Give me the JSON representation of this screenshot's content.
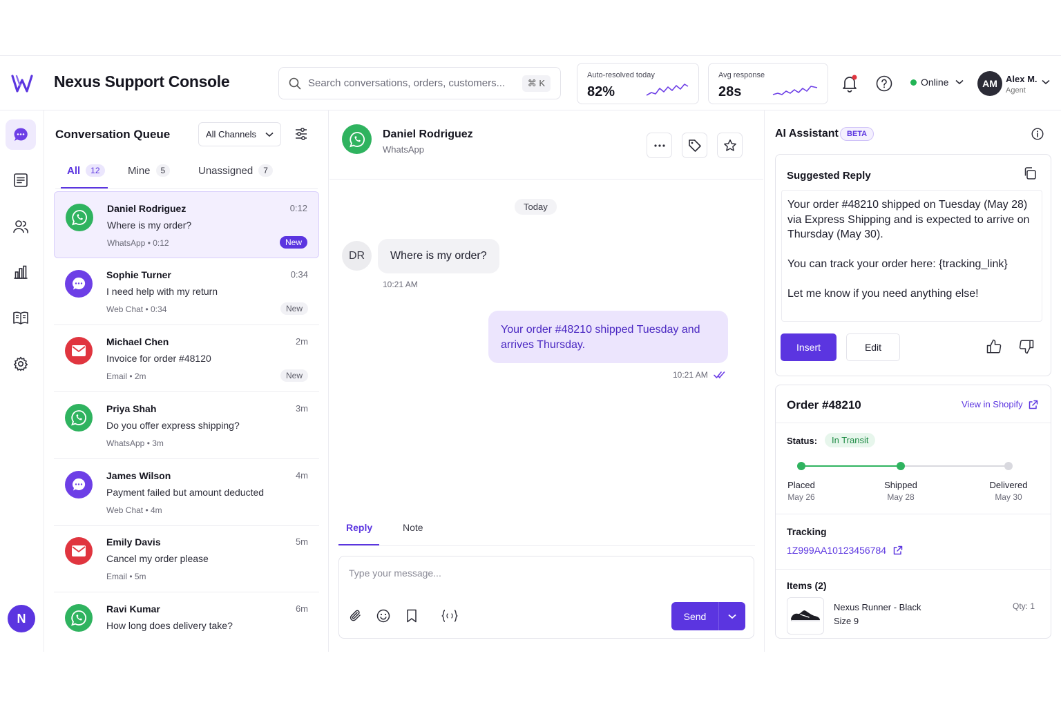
{
  "header": {
    "app_title": "Nexus Support Console",
    "search_placeholder": "Search conversations, orders, customers...",
    "search_shortcut": "⌘ K",
    "kpis": [
      {
        "label": "Auto-resolved today",
        "value": "82%"
      },
      {
        "label": "Avg response",
        "value": "28s"
      }
    ],
    "status": "Online",
    "status_color": "#22b455",
    "user": {
      "initials": "AM",
      "name": "Alex M.",
      "role": "Agent"
    }
  },
  "rail": {
    "items": [
      "chat-icon",
      "notes-icon",
      "users-icon",
      "chart-icon",
      "book-icon",
      "settings-icon"
    ],
    "active": "chat-icon",
    "avatar": "N"
  },
  "queue": {
    "title": "Conversation Queue",
    "channel_filter": "All Channels",
    "tabs": [
      {
        "label": "All",
        "count": "12"
      },
      {
        "label": "Mine",
        "count": "5"
      },
      {
        "label": "Unassigned",
        "count": "7"
      }
    ],
    "conversations": [
      {
        "name": "Daniel Rodriguez",
        "message": "Where is my order?",
        "meta": "WhatsApp • 0:12",
        "time": "0:12",
        "badge": "New",
        "channel": "whatsapp"
      },
      {
        "name": "Sophie Turner",
        "message": "I need help with my return",
        "meta": "Web Chat • 0:34",
        "time": "0:34",
        "badge": "New",
        "channel": "webchat"
      },
      {
        "name": "Michael Chen",
        "message": "Invoice for order #48120",
        "meta": "Email • 2m",
        "time": "2m",
        "badge": "New",
        "channel": "email"
      },
      {
        "name": "Priya Shah",
        "message": "Do you offer express shipping?",
        "meta": "WhatsApp • 3m",
        "time": "3m",
        "badge": "",
        "channel": "whatsapp"
      },
      {
        "name": "James Wilson",
        "message": "Payment failed but amount deducted",
        "meta": "Web Chat • 4m",
        "time": "4m",
        "badge": "",
        "channel": "webchat"
      },
      {
        "name": "Emily Davis",
        "message": "Cancel my order please",
        "meta": "Email • 5m",
        "time": "5m",
        "badge": "",
        "channel": "email"
      },
      {
        "name": "Ravi Kumar",
        "message": "How long does delivery take?",
        "meta": "",
        "time": "6m",
        "badge": "",
        "channel": "whatsapp"
      }
    ]
  },
  "chat": {
    "contact_name": "Daniel Rodriguez",
    "contact_channel": "WhatsApp",
    "day_separator": "Today",
    "incoming": {
      "initials": "DR",
      "text": "Where is my order?",
      "time": "10:21 AM"
    },
    "outgoing": {
      "text": "Your order #48210 shipped Tuesday and arrives Thursday.",
      "time": "10:21 AM"
    },
    "reply_tabs": [
      "Reply",
      "Note"
    ],
    "composer_placeholder": "Type your message...",
    "send_label": "Send"
  },
  "ai": {
    "title": "AI Assistant",
    "badge": "BETA",
    "suggested": {
      "title": "Suggested Reply",
      "paragraphs": [
        "Your order #48210 shipped on Tuesday (May 28) via Express Shipping and is expected to arrive on Thursday (May 30).",
        "You can track your order here: {tracking_link}",
        "Let me know if you need anything else!"
      ],
      "insert_label": "Insert",
      "edit_label": "Edit"
    },
    "order": {
      "title": "Order #48210",
      "link_label": "View in Shopify",
      "status_label": "Status:",
      "status": "In Transit",
      "steps": [
        {
          "name": "Placed",
          "date": "May 26",
          "done": true
        },
        {
          "name": "Shipped",
          "date": "May 28",
          "done": true
        },
        {
          "name": "Delivered",
          "date": "May 30",
          "done": false
        }
      ],
      "tracking_label": "Tracking",
      "tracking_number": "1Z999AA10123456784",
      "items_label": "Items (2)",
      "item": {
        "name": "Nexus Runner - Black",
        "size": "Size 9",
        "qty": "Qty: 1"
      }
    }
  },
  "colors": {
    "accent": "#5b35e0",
    "whatsapp": "#2fb35f",
    "webchat": "#6d3fe6",
    "email": "#e0353f"
  }
}
